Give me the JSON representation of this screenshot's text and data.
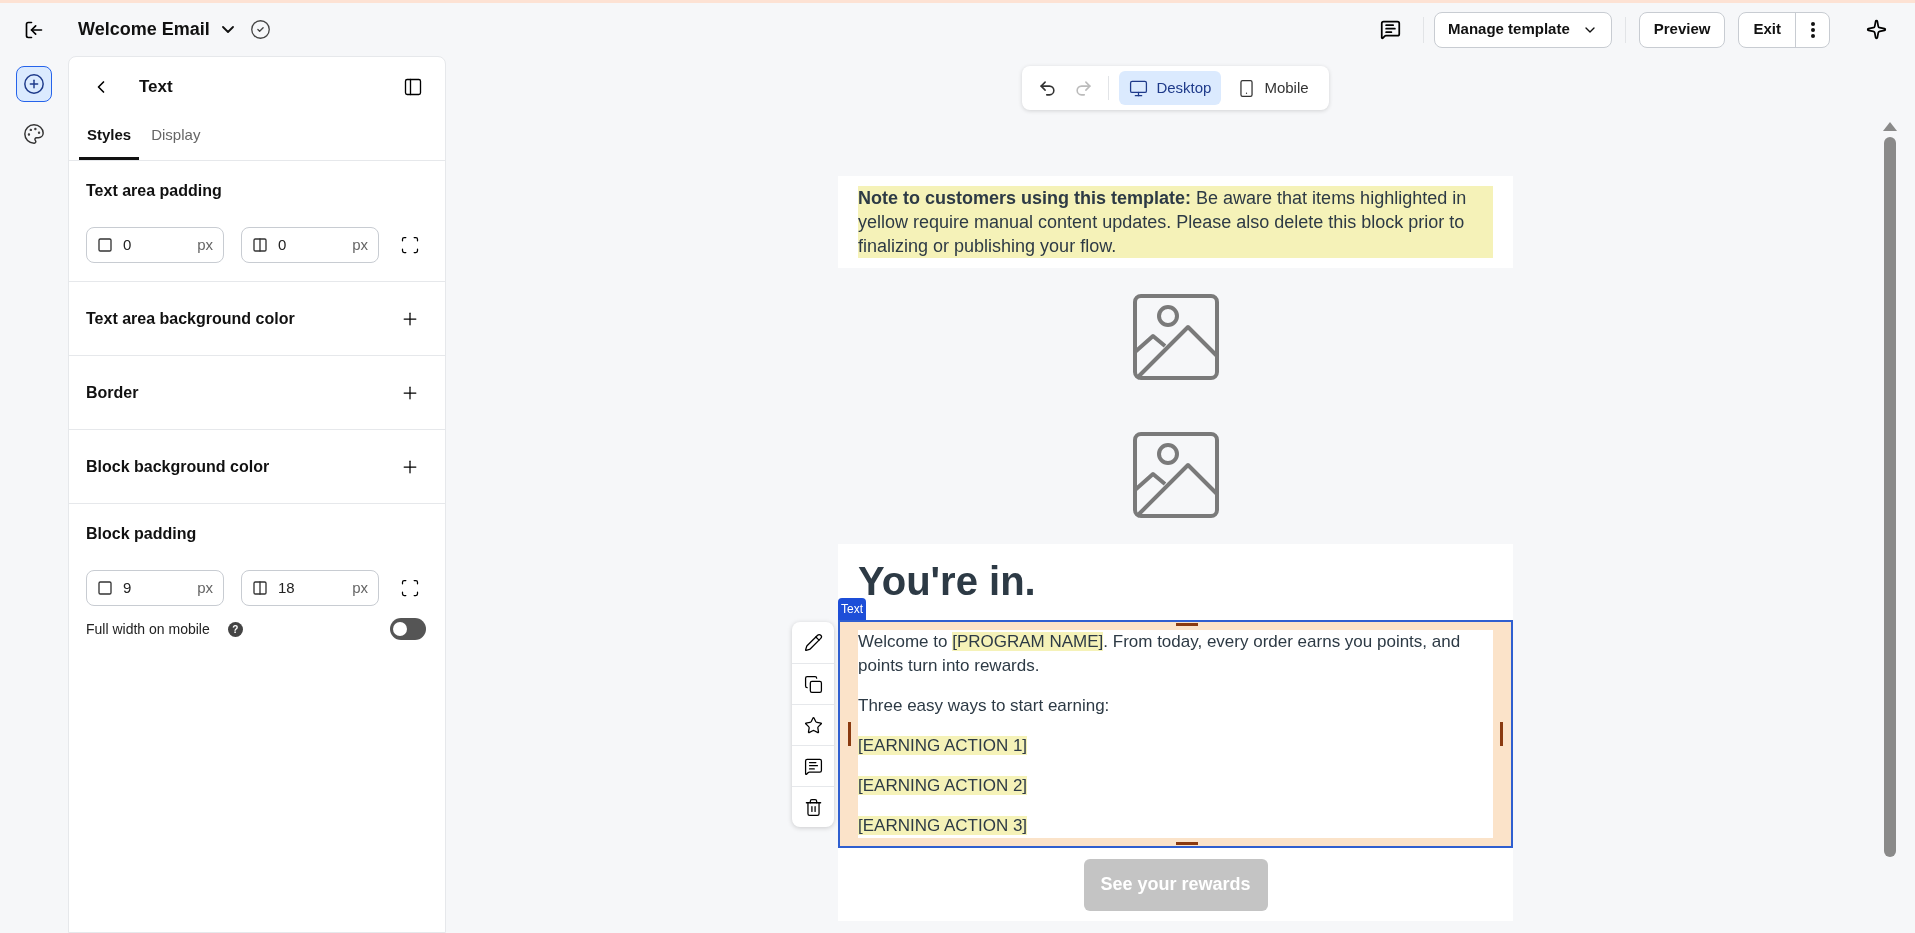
{
  "header": {
    "title": "Welcome Email",
    "actions": [
      {
        "kind": "menu",
        "label": "Manage template"
      },
      {
        "kind": "plain",
        "label": "Preview"
      },
      {
        "kind": "split",
        "label": "Exit"
      }
    ]
  },
  "rail": [
    {
      "kind": "add",
      "selected": true
    },
    {
      "kind": "palette",
      "selected": false
    }
  ],
  "panel": {
    "title": "Text",
    "tabs": [
      {
        "label": "Styles",
        "selected": true
      },
      {
        "label": "Display",
        "selected": false
      }
    ],
    "sections": [
      {
        "kind": "padding",
        "title": "Text area padding",
        "fields": [
          {
            "kind": "vertical",
            "value": "0",
            "unit": "px"
          },
          {
            "kind": "horizontal",
            "value": "0",
            "unit": "px"
          }
        ]
      },
      {
        "kind": "add",
        "title": "Text area background color"
      },
      {
        "kind": "add",
        "title": "Border"
      },
      {
        "kind": "add",
        "title": "Block background color"
      },
      {
        "kind": "padding",
        "title": "Block padding",
        "fields": [
          {
            "kind": "vertical",
            "value": "9",
            "unit": "px"
          },
          {
            "kind": "horizontal",
            "value": "18",
            "unit": "px"
          }
        ],
        "toggle": {
          "label": "Full width on mobile",
          "help": "?",
          "on": false
        }
      }
    ]
  },
  "toolbar": {
    "undo_enabled": true,
    "redo_enabled": false,
    "devices": [
      {
        "kind": "desktop",
        "label": "Desktop",
        "selected": true
      },
      {
        "kind": "mobile",
        "label": "Mobile",
        "selected": false
      }
    ]
  },
  "email": {
    "note": "**Note to customers using this template:** Be aware that items highlighted in yellow require manual content updates. Please also delete this block prior to finalizing or publishing your flow.",
    "images": [
      {
        "kind": "placeholder"
      },
      {
        "kind": "placeholder"
      }
    ],
    "heading": "You're in.",
    "selected_block": {
      "tag": "Text",
      "paragraphs": [
        [
          {
            "text": "Welcome to ",
            "highlighted": false
          },
          {
            "text": "[PROGRAM NAME]",
            "highlighted": true
          },
          {
            "text": ". From today, every order earns you points, and points turn into rewards.",
            "highlighted": false
          }
        ],
        [
          {
            "text": "Three easy ways to start earning:",
            "highlighted": false
          }
        ],
        [
          {
            "text": "[EARNING ACTION 1]",
            "highlighted": true
          }
        ],
        [
          {
            "text": "[EARNING ACTION 2]",
            "highlighted": true
          }
        ],
        [
          {
            "text": "[EARNING ACTION 3]",
            "highlighted": true
          }
        ]
      ]
    },
    "block_actions": [
      {
        "kind": "edit"
      },
      {
        "kind": "duplicate"
      },
      {
        "kind": "favorite"
      },
      {
        "kind": "comment"
      },
      {
        "kind": "delete"
      }
    ],
    "button": "See your rewards"
  }
}
